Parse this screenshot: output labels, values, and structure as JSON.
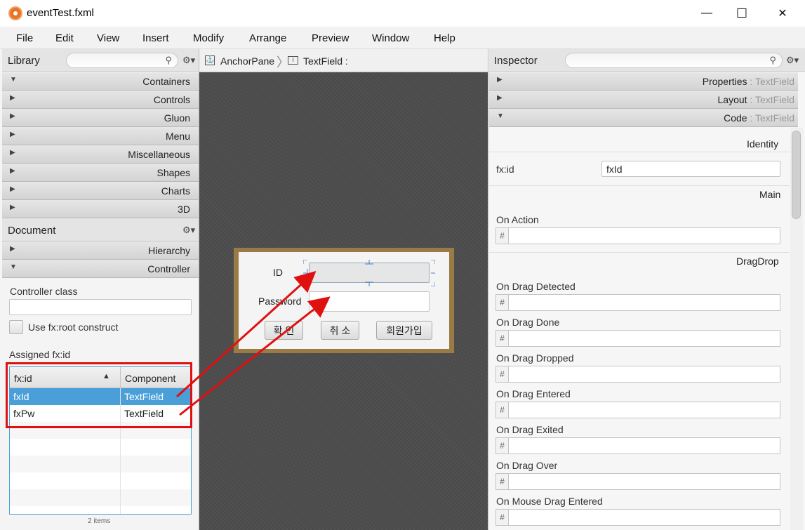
{
  "window": {
    "title": "eventTest.fxml",
    "minimize": "—",
    "maximize": "☐",
    "close": "✕"
  },
  "menu": [
    "File",
    "Edit",
    "View",
    "Insert",
    "Modify",
    "Arrange",
    "Preview",
    "Window",
    "Help"
  ],
  "library": {
    "title": "Library",
    "sections": [
      "Containers",
      "Controls",
      "Gluon",
      "Menu",
      "Miscellaneous",
      "Shapes",
      "Charts",
      "3D"
    ]
  },
  "document": {
    "title": "Document",
    "sections": [
      "Hierarchy",
      "Controller"
    ],
    "controller_class_label": "Controller class",
    "controller_class_value": "",
    "fxroot_label": "Use fx:root construct",
    "assigned_label": "Assigned fx:id",
    "table": {
      "headers": [
        "fx:id",
        "Component"
      ],
      "rows": [
        {
          "id": "fxId",
          "component": "TextField"
        },
        {
          "id": "fxPw",
          "component": "TextField"
        }
      ],
      "footer": "2 items"
    }
  },
  "breadcrumb": {
    "first": "AnchorPane",
    "second": "TextField :"
  },
  "form": {
    "id_label": "ID",
    "password_label": "Password",
    "buttons": [
      "확 인",
      "취 소",
      "회원가입"
    ]
  },
  "inspector": {
    "title": "Inspector",
    "sections": [
      {
        "name": "Properties",
        "sub": "TextField"
      },
      {
        "name": "Layout",
        "sub": "TextField"
      },
      {
        "name": "Code",
        "sub": "TextField"
      }
    ],
    "separator": " : ",
    "identity_group": "Identity",
    "fxid_label": "fx:id",
    "fxid_value": "fxId",
    "main_group": "Main",
    "on_action": "On Action",
    "dragdrop_group": "DragDrop",
    "drag_events": [
      "On Drag Detected",
      "On Drag Done",
      "On Drag Dropped",
      "On Drag Entered",
      "On Drag Exited",
      "On Drag Over",
      "On Mouse Drag Entered"
    ],
    "hash": "#"
  },
  "colors": {
    "selection": "#4a9fd8",
    "annotation": "#e01010",
    "form_border": "#9a7b45"
  }
}
